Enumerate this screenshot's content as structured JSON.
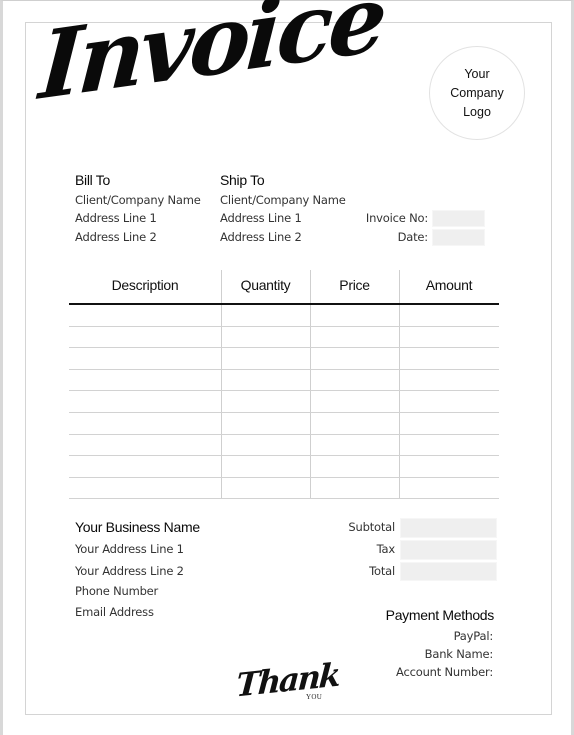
{
  "document": {
    "title": "Invoice",
    "logo_placeholder": [
      "Your",
      "Company",
      "Logo"
    ]
  },
  "bill_to": {
    "heading": "Bill To",
    "lines": [
      "Client/Company Name",
      "Address Line 1",
      "Address Line 2"
    ]
  },
  "ship_to": {
    "heading": "Ship To",
    "lines": [
      "Client/Company Name",
      "Address Line 1",
      "Address Line 2"
    ]
  },
  "meta": {
    "invoice_no_label": "Invoice No:",
    "invoice_no_value": "",
    "date_label": "Date:",
    "date_value": ""
  },
  "table": {
    "headers": [
      "Description",
      "Quantity",
      "Price",
      "Amount"
    ],
    "rows": [
      [
        "",
        "",
        "",
        ""
      ],
      [
        "",
        "",
        "",
        ""
      ],
      [
        "",
        "",
        "",
        ""
      ],
      [
        "",
        "",
        "",
        ""
      ],
      [
        "",
        "",
        "",
        ""
      ],
      [
        "",
        "",
        "",
        ""
      ],
      [
        "",
        "",
        "",
        ""
      ],
      [
        "",
        "",
        "",
        ""
      ],
      [
        "",
        "",
        "",
        ""
      ]
    ]
  },
  "business": {
    "name": "Your Business Name",
    "lines": [
      "Your Address Line 1",
      "Your Address Line 2",
      "Phone Number",
      "Email Address"
    ]
  },
  "totals": {
    "subtotal_label": "Subtotal",
    "subtotal_value": "",
    "tax_label": "Tax",
    "tax_value": "",
    "total_label": "Total",
    "total_value": ""
  },
  "payment": {
    "heading": "Payment Methods",
    "lines": [
      "PayPal:",
      "Bank Name:",
      "Account Number:"
    ]
  },
  "footer": {
    "thank": "Thank",
    "you": "YOU"
  }
}
